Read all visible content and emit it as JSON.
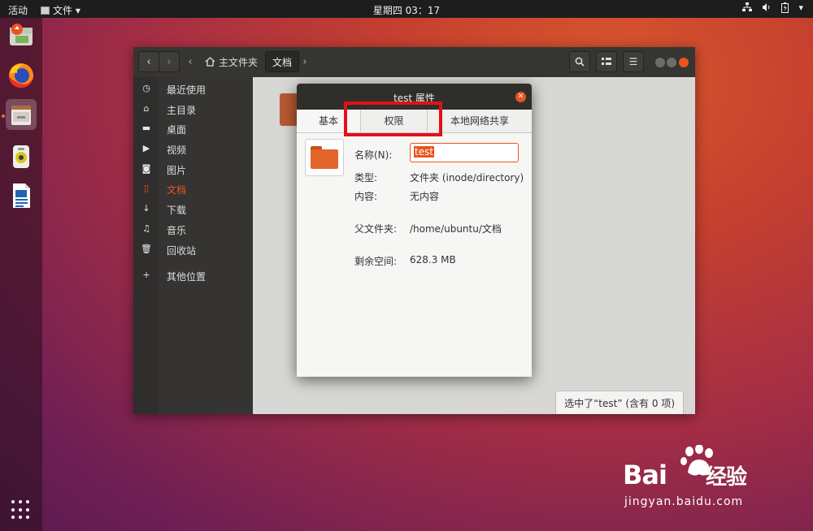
{
  "topbar": {
    "activities": "活动",
    "app_menu": "文件 ▾",
    "clock": "星期四 03：17"
  },
  "files_window": {
    "path": [
      "主文件夹",
      "文档"
    ],
    "sidebar": [
      {
        "label": "最近使用",
        "icon": "clock-icon"
      },
      {
        "label": "主目录",
        "icon": "home-icon"
      },
      {
        "label": "桌面",
        "icon": "folder-icon"
      },
      {
        "label": "视频",
        "icon": "video-icon"
      },
      {
        "label": "图片",
        "icon": "camera-icon"
      },
      {
        "label": "文档",
        "icon": "document-icon",
        "selected": true
      },
      {
        "label": "下载",
        "icon": "download-icon"
      },
      {
        "label": "音乐",
        "icon": "music-icon"
      },
      {
        "label": "回收站",
        "icon": "trash-icon"
      },
      {
        "label": "其他位置",
        "icon": "plus-icon"
      }
    ],
    "status": "选中了“test” (含有 0 项)"
  },
  "dialog": {
    "title": "test 属性",
    "tabs": [
      "基本",
      "权限",
      "本地网络共享"
    ],
    "active_tab": "基本",
    "name_label": "名称(N):",
    "name_value": "test",
    "type_label": "类型:",
    "type_value": "文件夹 (inode/directory)",
    "contents_label": "内容:",
    "contents_value": "无内容",
    "parent_label": "父文件夹:",
    "parent_value": "/home/ubuntu/文档",
    "free_label": "剩余空间:",
    "free_value": "628.3 MB"
  },
  "watermark": {
    "brand": "Bai",
    "brand_cn": "经验",
    "url": "jingyan.baidu.com"
  },
  "colors": {
    "accent": "#e95420",
    "highlight": "#e3101a"
  }
}
